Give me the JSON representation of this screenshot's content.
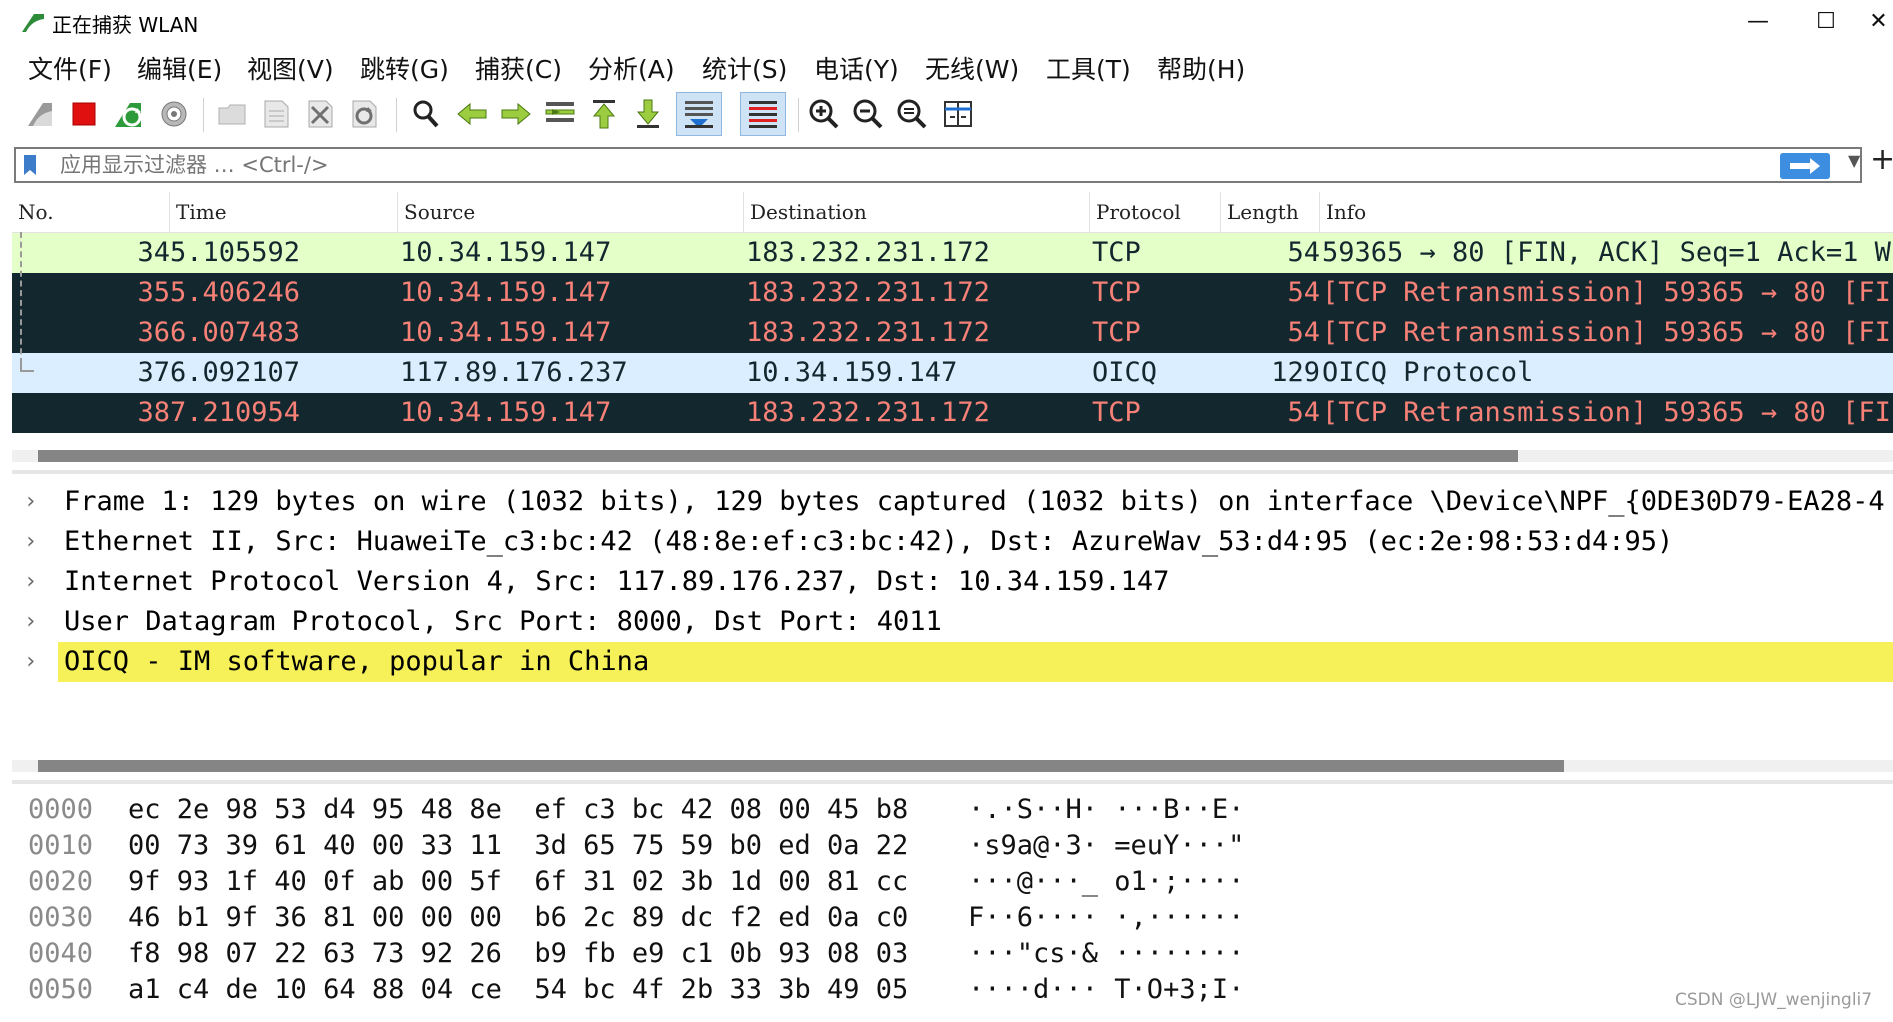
{
  "window": {
    "title": "正在捕获 WLAN",
    "minimize_label": "—",
    "maximize_label": "☐",
    "close_label": "✕"
  },
  "menu": [
    {
      "label": "文件(F)"
    },
    {
      "label": "编辑(E)"
    },
    {
      "label": "视图(V)"
    },
    {
      "label": "跳转(G)"
    },
    {
      "label": "捕获(C)"
    },
    {
      "label": "分析(A)"
    },
    {
      "label": "统计(S)"
    },
    {
      "label": "电话(Y)"
    },
    {
      "label": "无线(W)"
    },
    {
      "label": "工具(T)"
    },
    {
      "label": "帮助(H)"
    }
  ],
  "toolbar": {
    "icons": [
      "shark-fin-start-icon",
      "stop-capture-icon",
      "restart-capture-icon",
      "capture-options-icon",
      "open-file-icon",
      "save-file-icon",
      "close-file-icon",
      "reload-file-icon",
      "find-packet-icon",
      "go-back-icon",
      "go-forward-icon",
      "go-to-packet-icon",
      "go-first-icon",
      "go-last-icon",
      "auto-scroll-icon",
      "colorize-icon",
      "zoom-in-icon",
      "zoom-out-icon",
      "zoom-normal-icon",
      "resize-columns-icon"
    ]
  },
  "filter": {
    "placeholder": "应用显示过滤器 … <Ctrl-/>",
    "add_label": "+"
  },
  "packet_list": {
    "columns": [
      "No.",
      "Time",
      "Source",
      "Destination",
      "Protocol",
      "Length",
      "Info"
    ],
    "rows": [
      {
        "no": "34",
        "time": "5.105592",
        "source": "10.34.159.147",
        "destination": "183.232.231.172",
        "protocol": "TCP",
        "length": "54",
        "info": "59365 → 80 [FIN, ACK] Seq=1 Ack=1 W",
        "style": "green"
      },
      {
        "no": "35",
        "time": "5.406246",
        "source": "10.34.159.147",
        "destination": "183.232.231.172",
        "protocol": "TCP",
        "length": "54",
        "info": "[TCP Retransmission] 59365 → 80 [FI",
        "style": "dark"
      },
      {
        "no": "36",
        "time": "6.007483",
        "source": "10.34.159.147",
        "destination": "183.232.231.172",
        "protocol": "TCP",
        "length": "54",
        "info": "[TCP Retransmission] 59365 → 80 [FI",
        "style": "dark"
      },
      {
        "no": "37",
        "time": "6.092107",
        "source": "117.89.176.237",
        "destination": "10.34.159.147",
        "protocol": "OICQ",
        "length": "129",
        "info": "OICQ Protocol",
        "style": "blue"
      },
      {
        "no": "38",
        "time": "7.210954",
        "source": "10.34.159.147",
        "destination": "183.232.231.172",
        "protocol": "TCP",
        "length": "54",
        "info": "[TCP Retransmission] 59365 → 80 [FI",
        "style": "dark"
      }
    ]
  },
  "details": [
    {
      "text": "Frame 1: 129 bytes on wire (1032 bits), 129 bytes captured (1032 bits) on interface \\Device\\NPF_{0DE30D79-EA28-4",
      "selected": false
    },
    {
      "text": "Ethernet II, Src: HuaweiTe_c3:bc:42 (48:8e:ef:c3:bc:42), Dst: AzureWav_53:d4:95 (ec:2e:98:53:d4:95)",
      "selected": false
    },
    {
      "text": "Internet Protocol Version 4, Src: 117.89.176.237, Dst: 10.34.159.147",
      "selected": false
    },
    {
      "text": "User Datagram Protocol, Src Port: 8000, Dst Port: 4011",
      "selected": false
    },
    {
      "text": "OICQ - IM software, popular in China",
      "selected": true
    }
  ],
  "detail_chevron": "›",
  "hex_dump": [
    {
      "offset": "0000",
      "hex": "ec 2e 98 53 d4 95 48 8e  ef c3 bc 42 08 00 45 b8",
      "ascii": "·.·S··H· ···B··E·"
    },
    {
      "offset": "0010",
      "hex": "00 73 39 61 40 00 33 11  3d 65 75 59 b0 ed 0a 22",
      "ascii": "·s9a@·3· =euY···\""
    },
    {
      "offset": "0020",
      "hex": "9f 93 1f 40 0f ab 00 5f  6f 31 02 3b 1d 00 81 cc",
      "ascii": "···@···_ o1·;····"
    },
    {
      "offset": "0030",
      "hex": "46 b1 9f 36 81 00 00 00  b6 2c 89 dc f2 ed 0a c0",
      "ascii": "F··6···· ·,······"
    },
    {
      "offset": "0040",
      "hex": "f8 98 07 22 63 73 92 26  b9 fb e9 c1 0b 93 08 03",
      "ascii": "···\"cs·& ········"
    },
    {
      "offset": "0050",
      "hex": "a1 c4 de 10 64 88 04 ce  54 bc 4f 2b 33 3b 49 05",
      "ascii": "····d··· T·O+3;I·"
    }
  ],
  "watermark": "CSDN @LJW_wenjingli7",
  "colors": {
    "row_green_bg": "#e4ffc7",
    "row_dark_bg": "#12272e",
    "row_dark_fg": "#f78077",
    "row_blue_bg": "#daeeff",
    "selected_detail_bg": "#f6f158"
  }
}
